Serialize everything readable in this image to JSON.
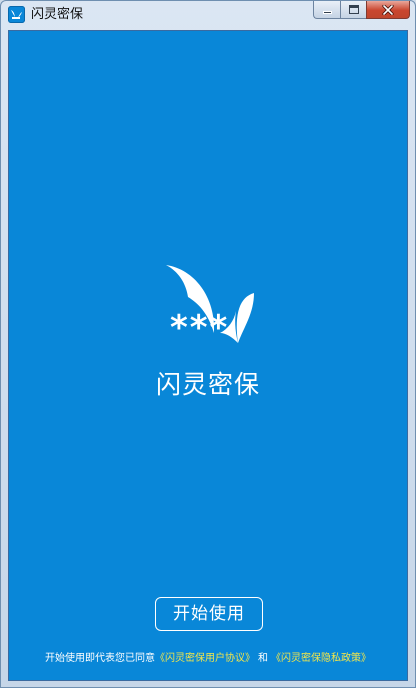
{
  "window": {
    "title": "闪灵密保",
    "icon": "app-logo-icon"
  },
  "caption_buttons": {
    "minimize_icon": "minimize-icon",
    "maximize_icon": "maximize-icon",
    "close_icon": "close-icon"
  },
  "splash": {
    "logo_icon": "butterfly-logo-icon",
    "logo_stars": "***",
    "brand_name": "闪灵密保",
    "start_button_label": "开始使用",
    "agreement": {
      "prefix": "开始使用即代表您已同意",
      "user_agreement": "《闪灵密保用户协议》",
      "conjunction": "和",
      "privacy_policy": "《闪灵密保隐私政策》"
    }
  },
  "colors": {
    "background": "#0987d8",
    "link": "#f2e64a",
    "text": "#ffffff"
  }
}
